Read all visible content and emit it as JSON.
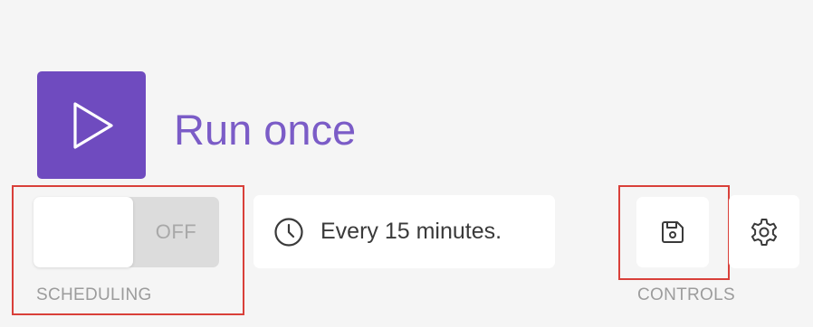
{
  "run": {
    "label": "Run once",
    "icon": "play-icon"
  },
  "scheduling": {
    "toggle_state": "OFF",
    "caption": "SCHEDULING",
    "interval_text": "Every 15 minutes.",
    "interval_icon": "clock-icon"
  },
  "controls": {
    "caption": "CONTROLS",
    "save_icon": "floppy-disk-icon",
    "settings_icon": "gear-icon"
  },
  "colors": {
    "accent": "#6f4bbf",
    "accent_text": "#7b5cc7",
    "highlight": "#d9403a",
    "background": "#f5f5f5"
  }
}
